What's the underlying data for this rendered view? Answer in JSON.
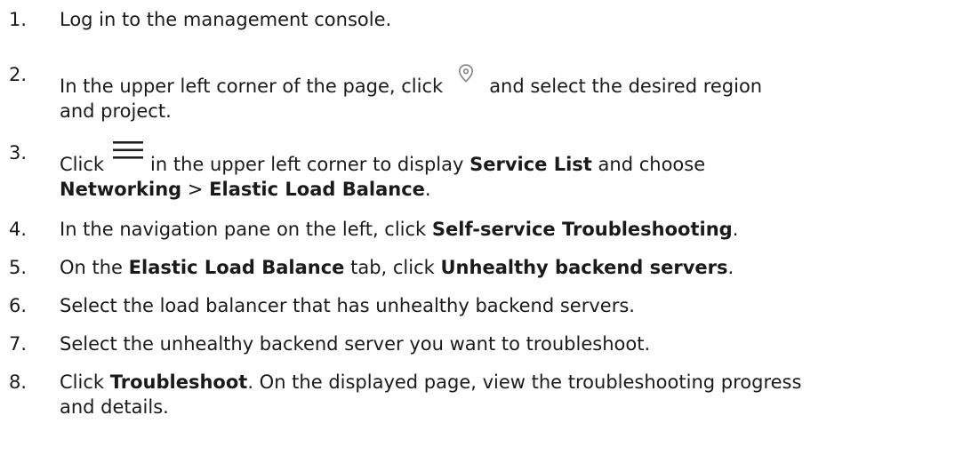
{
  "steps": [
    {
      "number": "1.",
      "text": "Log in to the management console."
    },
    {
      "number": "2.",
      "before_icon": "In the upper left corner of the page, click",
      "icon": "location-pin-icon",
      "after_icon": "and select the desired region",
      "line2": "and project."
    },
    {
      "number": "3.",
      "before_icon": "Click",
      "icon": "menu-icon",
      "after_icon": "in the upper left corner to display",
      "bold1": "Service List",
      "text2": "and choose",
      "bold2": "Networking",
      "sep": ">",
      "bold3": "Elastic Load Balance",
      "end": "."
    },
    {
      "number": "4.",
      "text": "In the navigation pane on the left, click",
      "bold": "Self-service Troubleshooting",
      "end": "."
    },
    {
      "number": "5.",
      "text1": "On the",
      "bold1": "Elastic Load Balance",
      "text2": "tab, click",
      "bold2": "Unhealthy backend servers",
      "end": "."
    },
    {
      "number": "6.",
      "text": "Select the load balancer that has unhealthy backend servers."
    },
    {
      "number": "7.",
      "text": "Select the unhealthy backend server you want to troubleshoot."
    },
    {
      "number": "8.",
      "before": "Click",
      "bold": "Troubleshoot",
      "after": ". On the displayed page, view the troubleshooting progress",
      "line2": "and details."
    }
  ],
  "colors": {
    "text": "#1a1a1a",
    "icon_gray": "#8c8c8c",
    "menu_icon": "#1f1f1f"
  }
}
